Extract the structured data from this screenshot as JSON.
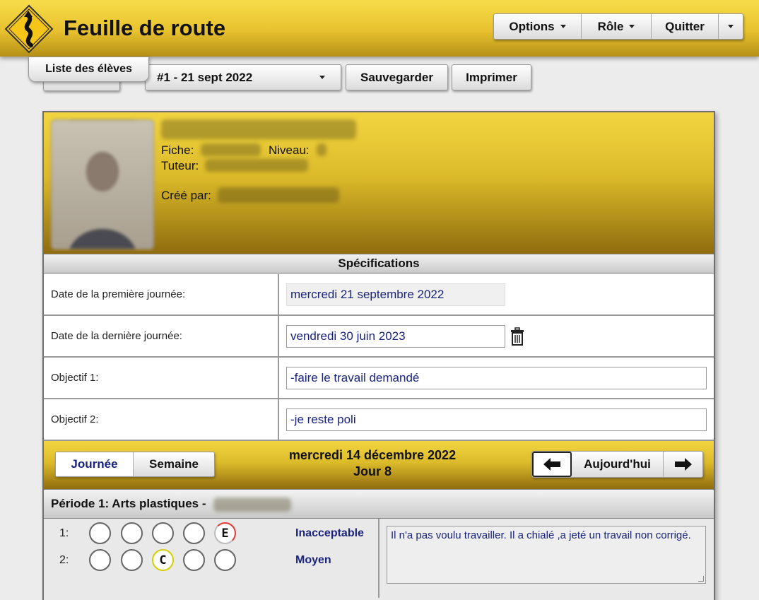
{
  "header": {
    "title": "Feuille de route",
    "menu": {
      "options": "Options",
      "role": "Rôle",
      "quit": "Quitter"
    }
  },
  "toolbar": {
    "students_tab": "Liste des élèves",
    "sheet_select": "#1 - 21 sept 2022",
    "save": "Sauvegarder",
    "print": "Imprimer"
  },
  "profile": {
    "fiche_label": "Fiche:",
    "niveau_label": "Niveau:",
    "tuteur_label": "Tuteur:",
    "cree_label": "Créé par:"
  },
  "specs": {
    "title": "Spécifications",
    "rows": [
      {
        "label": "Date de la première journée:",
        "value": "mercredi 21 septembre 2022"
      },
      {
        "label": "Date de la dernière journée:",
        "value": "vendredi 30 juin 2023"
      },
      {
        "label": "Objectif 1:",
        "value": "-faire le travail demandé"
      },
      {
        "label": "Objectif 2:",
        "value": "-je reste poli"
      }
    ]
  },
  "daynav": {
    "day_tab": "Journée",
    "week_tab": "Semaine",
    "date": "mercredi 14 décembre 2022",
    "day": "Jour 8",
    "today": "Aujourd'hui",
    "prev_icon": "arrow-left-icon",
    "next_icon": "arrow-right-icon"
  },
  "period": {
    "title": "Période 1: Arts plastiques -",
    "rows": [
      {
        "num": "1:",
        "selected_index": 4,
        "selected_letter": "E",
        "selected_color": "#e53935",
        "rating": "Inacceptable"
      },
      {
        "num": "2:",
        "selected_index": 2,
        "selected_letter": "C",
        "selected_color": "#d4d000",
        "rating": "Moyen"
      }
    ],
    "comment": "Il n'a pas voulu travailler. Il a chialé ,a jeté un travail non corrigé."
  },
  "colors": {
    "accent_yellow": "#e8c22e",
    "link_blue": "#1a237e"
  }
}
